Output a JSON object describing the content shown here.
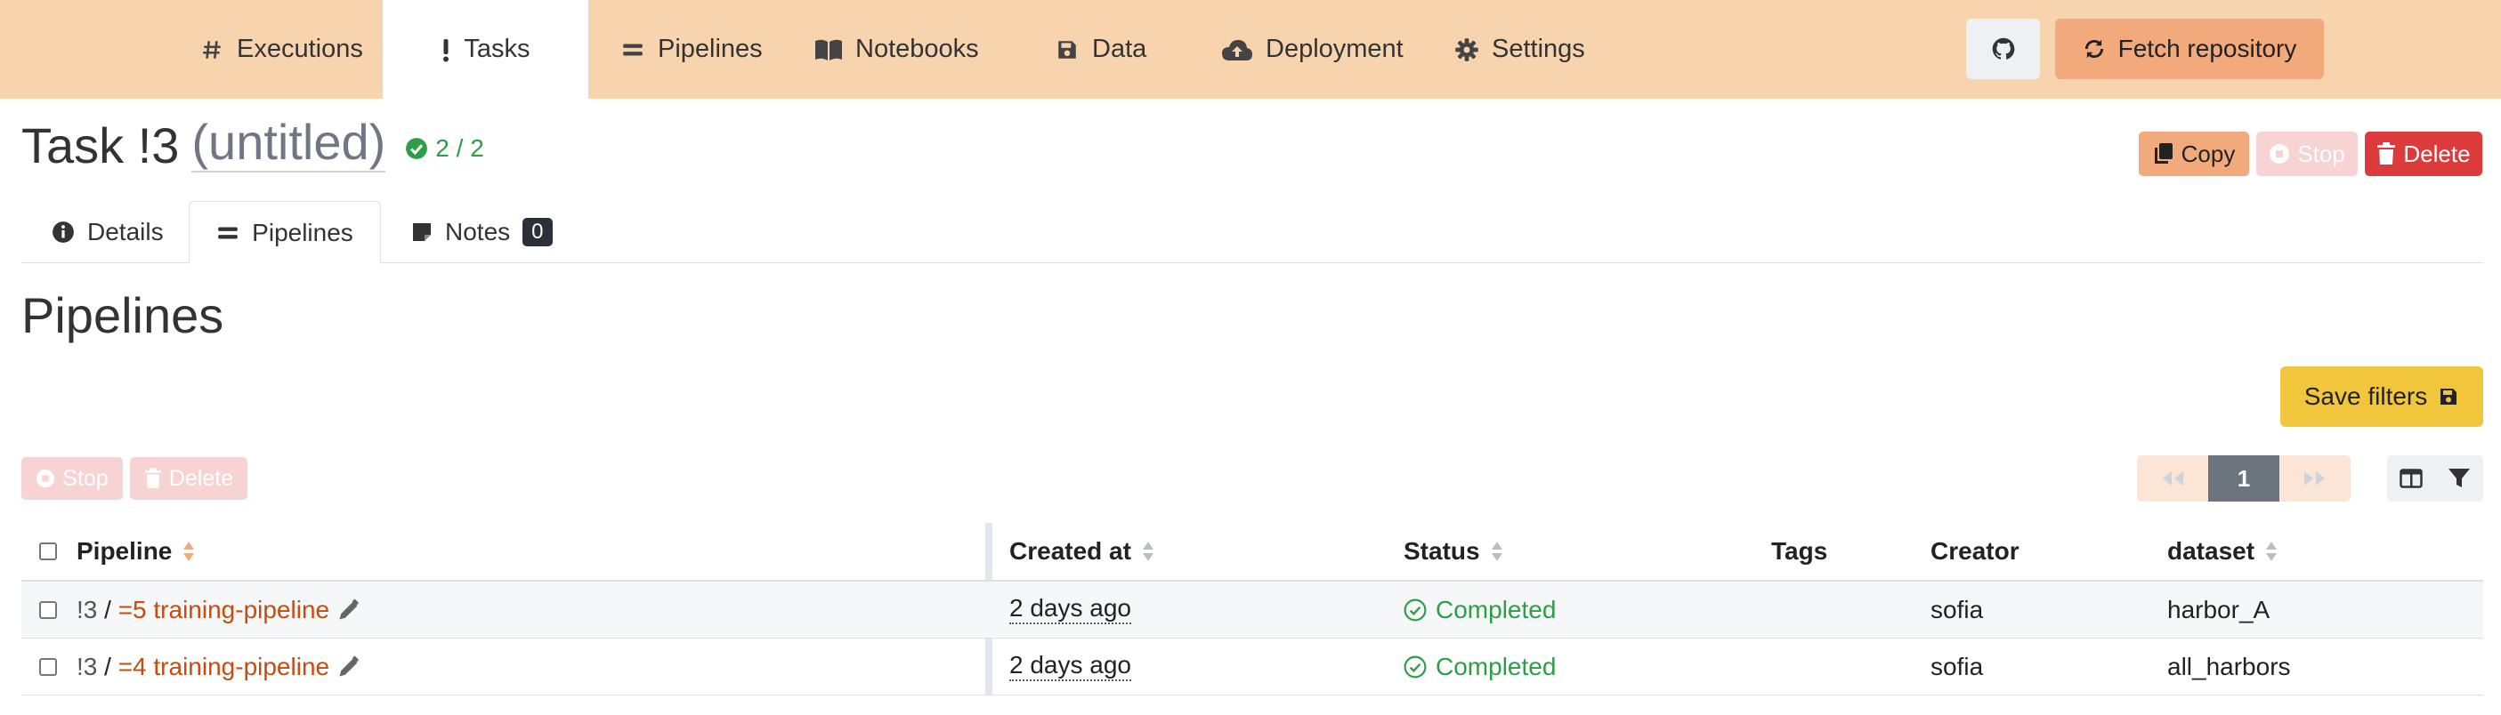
{
  "nav": {
    "items": [
      {
        "label": "Executions",
        "icon": "hash-icon"
      },
      {
        "label": "Tasks",
        "icon": "exclamation-icon"
      },
      {
        "label": "Pipelines",
        "icon": "equals-icon"
      },
      {
        "label": "Notebooks",
        "icon": "book-icon"
      },
      {
        "label": "Data",
        "icon": "floppy-icon"
      },
      {
        "label": "Deployment",
        "icon": "cloud-upload-icon"
      },
      {
        "label": "Settings",
        "icon": "gear-icon"
      }
    ],
    "fetch_label": "Fetch repository"
  },
  "task": {
    "title": "Task !3",
    "untitled": "(untitled)",
    "count": "2 / 2",
    "actions": {
      "copy": "Copy",
      "stop": "Stop",
      "delete": "Delete"
    }
  },
  "tabs": [
    {
      "label": "Details"
    },
    {
      "label": "Pipelines"
    },
    {
      "label": "Notes",
      "badge": "0"
    }
  ],
  "section_title": "Pipelines",
  "save_filters_label": "Save filters",
  "bulk": {
    "stop": "Stop",
    "delete": "Delete"
  },
  "pagination": {
    "current": "1"
  },
  "table": {
    "columns": [
      "Pipeline",
      "Created at",
      "Status",
      "Tags",
      "Creator",
      "dataset"
    ],
    "rows": [
      {
        "task": "!3",
        "sep": " / ",
        "pipeline": "=5 training-pipeline",
        "created": "2 days ago",
        "status": "Completed",
        "tags": "",
        "creator": "sofia",
        "dataset": "harbor_A"
      },
      {
        "task": "!3",
        "sep": " / ",
        "pipeline": "=4 training-pipeline",
        "created": "2 days ago",
        "status": "Completed",
        "tags": "",
        "creator": "sofia",
        "dataset": "all_harbors"
      }
    ]
  },
  "colors": {
    "nav_bg": "#f7d4ae",
    "accent": "#f2aa7c",
    "danger": "#dd3b3b",
    "success": "#2e9d47",
    "warning": "#f1c63c",
    "link": "#c44d0f"
  }
}
